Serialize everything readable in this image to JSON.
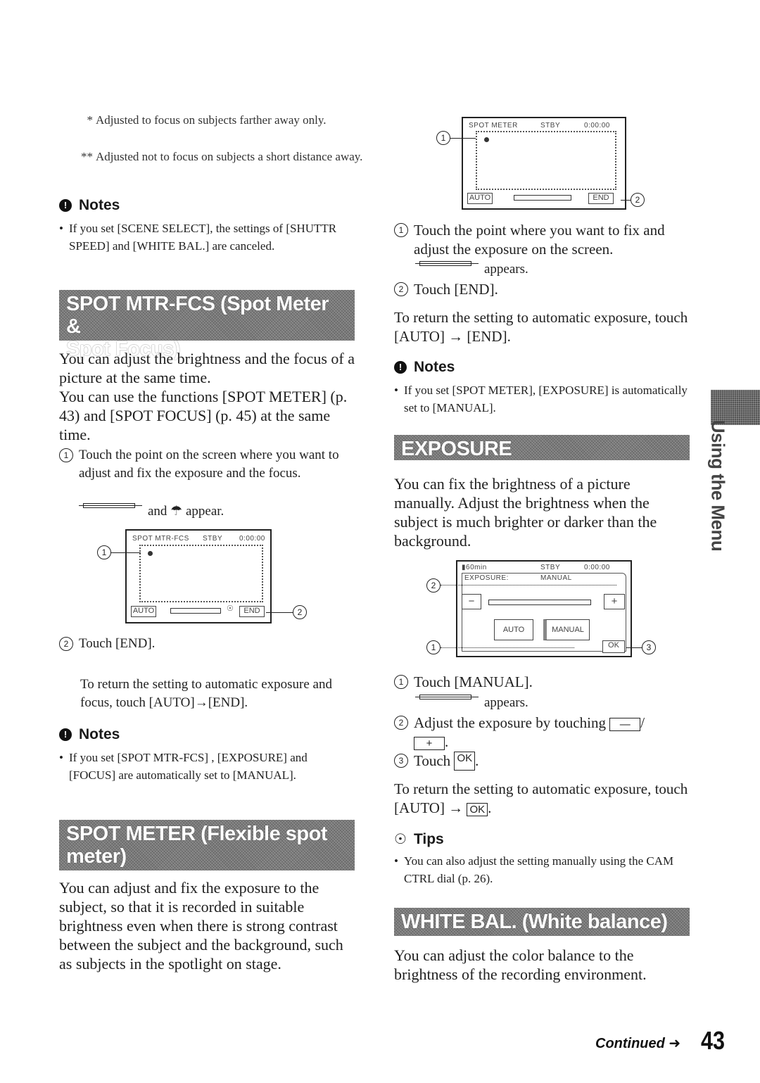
{
  "left_column": {
    "footnotes": [
      {
        "mark": "*",
        "text": "Adjusted to focus on subjects farther away only."
      },
      {
        "mark": "**",
        "text": "Adjusted not to focus on subjects a short distance away."
      }
    ],
    "notes1": {
      "heading": "Notes",
      "items": [
        "If you set [SCENE SELECT], the settings of [SHUTTR SPEED] and [WHITE BAL.] are canceled."
      ]
    },
    "section_spot_mtr_fcs": {
      "title_line1": "SPOT MTR-FCS (Spot Meter &",
      "title_line2": "Spot Focus)",
      "para1": "You can adjust the brightness and the focus of a picture at the same time.",
      "para2": "You can use the functions [SPOT METER] (p. 43) and [SPOT FOCUS] (p. 45) at the same time.",
      "step1": "Touch the point on the screen where you want to adjust and fix the exposure and the focus.",
      "step1_sub": "and ☂ appear.",
      "screen": {
        "title": "SPOT MTR-FCS",
        "status": "STBY",
        "time": "0:00:00",
        "auto_button": "AUTO",
        "end_button": "END",
        "callout1": "1",
        "callout2": "2"
      },
      "step2": "Touch [END].",
      "return_text": "To return the setting to automatic exposure and focus, touch [AUTO]→[END]."
    },
    "notes2": {
      "heading": "Notes",
      "items": [
        "If you set [SPOT MTR-FCS] , [EXPOSURE] and [FOCUS] are automatically set to [MANUAL]."
      ]
    },
    "section_spot_meter": {
      "title_line1": "SPOT METER (Flexible spot",
      "title_line2": "meter)",
      "para": "You can adjust and fix the exposure to the subject, so that it is recorded in suitable brightness even when there is strong contrast between the subject and the background, such as subjects in the spotlight on stage."
    }
  },
  "right_column": {
    "spot_meter_screen": {
      "title": "SPOT METER",
      "status": "STBY",
      "time": "0:00:00",
      "auto_button": "AUTO",
      "end_button": "END",
      "callout1": "1",
      "callout2": "2"
    },
    "spot_meter_steps": {
      "step1": "Touch the point where you want to fix and adjust the exposure on the screen.",
      "step1_sub": "appears.",
      "step2": "Touch [END].",
      "return_text": "To return the setting to automatic exposure, touch [AUTO] → [END]."
    },
    "notes3": {
      "heading": "Notes",
      "items": [
        "If you set [SPOT METER], [EXPOSURE] is automatically set to [MANUAL]."
      ]
    },
    "section_exposure": {
      "title": "EXPOSURE",
      "para": "You can fix the brightness of a picture manually. Adjust the brightness when the subject is much brighter or darker than the background.",
      "screen": {
        "battery": "60min",
        "status": "STBY",
        "time": "0:00:00",
        "label": "EXPOSURE:",
        "value": "MANUAL",
        "minus_button": "−",
        "plus_button": "+",
        "auto_button": "AUTO",
        "manual_button": "MANUAL",
        "ok_button": "OK",
        "callout1": "1",
        "callout2": "2",
        "callout3": "3"
      },
      "step1": "Touch [MANUAL].",
      "step1_sub": "appears.",
      "step2_prefix": "Adjust the exposure by touching",
      "step2_minus": "—",
      "step2_sep": "/",
      "step2_plus": "+",
      "step3_prefix": "Touch",
      "step3_ok": "OK",
      "return_prefix": "To return the setting to automatic exposure, touch [AUTO] →",
      "return_ok": "OK"
    },
    "tips": {
      "heading": "Tips",
      "items": [
        "You can also adjust the setting manually using the CAM CTRL dial (p. 26)."
      ]
    },
    "section_white_bal": {
      "title": "WHITE BAL. (White balance)",
      "para": "You can adjust the color balance to the brightness of the recording environment."
    }
  },
  "side_tab": {
    "label": "Using the Menu"
  },
  "footer": {
    "continued": "Continued",
    "page_number": "43"
  }
}
